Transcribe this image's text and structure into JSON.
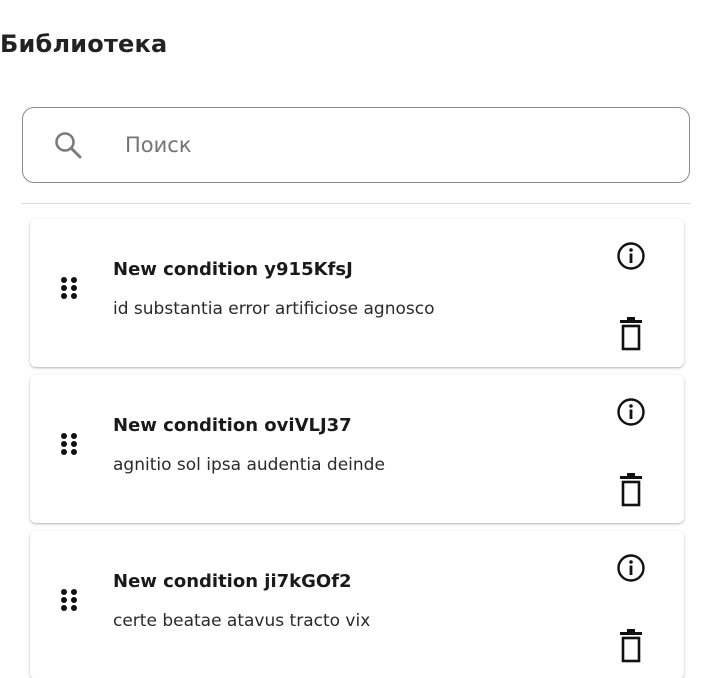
{
  "library": {
    "title": "Библиотека",
    "search": {
      "placeholder": "Поиск",
      "value": ""
    },
    "conditions": [
      {
        "name": "New condition y915KfsJ",
        "description": "id substantia error artificiose agnosco"
      },
      {
        "name": "New condition oviVLJ37",
        "description": "agnitio sol ipsa audentia deinde"
      },
      {
        "name": "New condition ji7kGOf2",
        "description": "certe beatae atavus tracto vix"
      }
    ]
  },
  "icons": {
    "search": "search-icon",
    "drag": "drag-handle-icon",
    "info": "info-icon",
    "delete": "trash-icon"
  },
  "colors": {
    "text": "#1f1f1f",
    "border": "#8a8a8a",
    "placeholder": "#747474",
    "divider": "#d9d9d9"
  }
}
